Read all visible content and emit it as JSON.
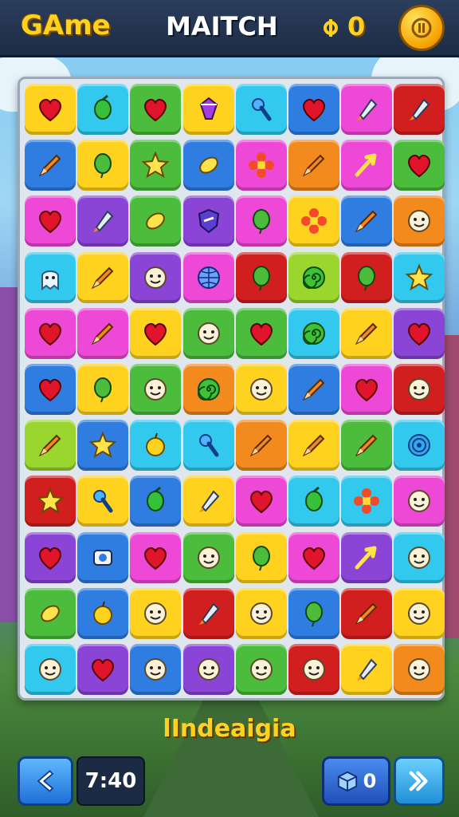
{
  "header": {
    "game_title": "GAme",
    "match_title": "MAITCH",
    "score_icon": "coin-symbol-icon",
    "score": "0",
    "pause_icon": "pause-icon"
  },
  "level_label": "lIndeaigia",
  "footer": {
    "back_icon": "back-arrow-icon",
    "moves": "7:40",
    "booster_icon": "cube-icon",
    "booster_count": "0",
    "next_icon": "forward-arrow-icon"
  },
  "colors": {
    "yellow": "#ffd21f",
    "cyan": "#33c9ee",
    "green": "#4cbc3c",
    "red": "#d11f1f",
    "blue": "#2f7de0",
    "pink": "#ee49d6",
    "orange": "#f38a1e",
    "purple": "#8b45d6",
    "lime": "#9ad62e",
    "magenta": "#e83cc8"
  },
  "board": {
    "rows": 11,
    "cols": 8,
    "tiles": [
      [
        "yellow:heart",
        "cyan:candy",
        "green:heart",
        "yellow:gem",
        "cyan:key",
        "blue:heart",
        "pink:rocket",
        "red:rocket"
      ],
      [
        "blue:pencil",
        "yellow:balloon",
        "green:star",
        "blue:leaf",
        "pink:flower",
        "orange:pencil",
        "pink:arrow",
        "green:heart"
      ],
      [
        "pink:heart",
        "purple:rocket",
        "green:leaf",
        "purple:shield",
        "pink:balloon",
        "yellow:flower",
        "blue:pencil",
        "orange:face"
      ],
      [
        "cyan:ghost",
        "yellow:pencil",
        "purple:face",
        "pink:globe",
        "red:balloon",
        "lime:swirl",
        "red:balloon",
        "cyan:star"
      ],
      [
        "pink:heart",
        "pink:pencil",
        "yellow:heart",
        "green:face",
        "green:heart",
        "cyan:swirl",
        "yellow:pencil",
        "purple:heart"
      ],
      [
        "blue:heart",
        "yellow:balloon",
        "green:face",
        "orange:swirl",
        "yellow:face",
        "blue:pencil",
        "pink:heart",
        "red:face"
      ],
      [
        "lime:pencil",
        "blue:star",
        "cyan:apple",
        "cyan:key",
        "orange:pencil",
        "yellow:pencil",
        "green:pencil",
        "cyan:target"
      ],
      [
        "red:star",
        "yellow:key",
        "blue:candy",
        "yellow:rocket",
        "pink:heart",
        "cyan:candy",
        "cyan:flower",
        "pink:face"
      ],
      [
        "purple:heart",
        "blue:cube",
        "pink:heart",
        "green:face",
        "yellow:balloon",
        "pink:heart",
        "purple:arrow",
        "cyan:face"
      ],
      [
        "green:leaf",
        "blue:apple",
        "yellow:face",
        "red:rocket",
        "yellow:face",
        "blue:balloon",
        "red:pencil",
        "yellow:face"
      ],
      [
        "cyan:face",
        "purple:heart",
        "blue:face",
        "purple:face",
        "green:face",
        "red:face",
        "yellow:rocket",
        "orange:face"
      ]
    ]
  }
}
